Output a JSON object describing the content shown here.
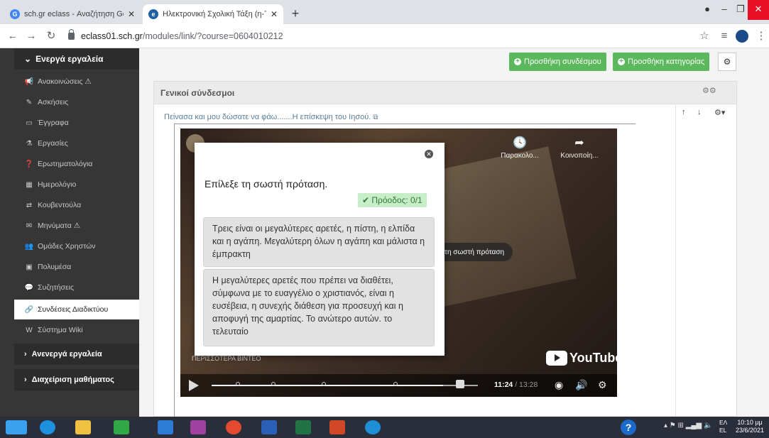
{
  "browser": {
    "tabs": [
      {
        "label": "sch.gr eclass - Αναζήτηση Google",
        "favicon": "google-icon"
      },
      {
        "label": "Ηλεκτρονική Σχολική Τάξη (η-Τάξη)",
        "favicon": "eclass-icon"
      }
    ],
    "new_tab": "+",
    "url_host": "eclass01.sch.gr",
    "url_path": "/modules/link/?course=0604010212"
  },
  "sidebar": {
    "active_tools_header": "Ενεργά εργαλεία",
    "items": [
      {
        "label": "Ανακοινώσεις ⚠",
        "icon": "megaphone-icon"
      },
      {
        "label": "Ασκήσεις",
        "icon": "edit-icon"
      },
      {
        "label": "Έγγραφα",
        "icon": "folder-icon"
      },
      {
        "label": "Εργασίες",
        "icon": "flask-icon"
      },
      {
        "label": "Ερωτηματολόγια",
        "icon": "question-icon"
      },
      {
        "label": "Ημερολόγιο",
        "icon": "calendar-icon"
      },
      {
        "label": "Κουβεντούλα",
        "icon": "exchange-icon"
      },
      {
        "label": "Μηνύματα ⚠",
        "icon": "envelope-icon"
      },
      {
        "label": "Ομάδες Χρηστών",
        "icon": "users-icon"
      },
      {
        "label": "Πολυμέσα",
        "icon": "film-icon"
      },
      {
        "label": "Συζητήσεις",
        "icon": "comments-icon"
      },
      {
        "label": "Συνδέσεις Διαδικτύου",
        "icon": "link-icon"
      },
      {
        "label": "Σύστημα Wiki",
        "icon": "wikipedia-icon"
      }
    ],
    "inactive_tools": "Ανενεργά εργαλεία",
    "course_admin": "Διαχείριση μαθήματος"
  },
  "toolbar": {
    "add_link": "Προσθήκη συνδέσμου",
    "add_category": "Προσθήκη κατηγορίας"
  },
  "panel": {
    "title": "Γενικοί σύνδεσμοι",
    "link_text": "Πείνασα και μου δώσατε να φάω.......Η επίσκεψη του Ιησού."
  },
  "video": {
    "watch_later": "Παρακολο...",
    "share": "Κοινοποίη...",
    "overlay_bubble": "τη σωστή πρόταση",
    "more_videos": "ΠΕΡΙΣΣΟΤΕΡΑ ΒΙΝΤΕΟ",
    "youtube": "YouTube",
    "time_current": "11:24",
    "time_total": " / 13:28",
    "progress": 0.87
  },
  "quiz": {
    "question": "Επίλεξε τη σωστή πρόταση.",
    "progress": "✔ Πρόοδος: 0/1",
    "answers": [
      "Τρεις είναι οι μεγαλύτερες αρετές, η πίστη, η ελπίδα και η αγάπη. Μεγαλύτερη όλων η αγάπη και μάλιστα η έμπρακτη",
      "Η μεγαλύτερες αρετές που πρέπει να διαθέτει, σύμφωνα με το ευαγγέλιο ο χριστιανός, είναι η ευσέβεια, η συνεχής διάθεση για προσευχή και η αποφυγή της αμαρτίας. Το ανώτερο αυτών. το τελευταίο"
    ]
  },
  "taskbar": {
    "lang_top": "ΕΛ",
    "lang_bottom": "EL",
    "time": "10:10 μμ",
    "date": "23/6/2021"
  },
  "colors": {
    "green": "#5cb85c",
    "sidebar": "#363636",
    "close_red": "#e81123"
  }
}
